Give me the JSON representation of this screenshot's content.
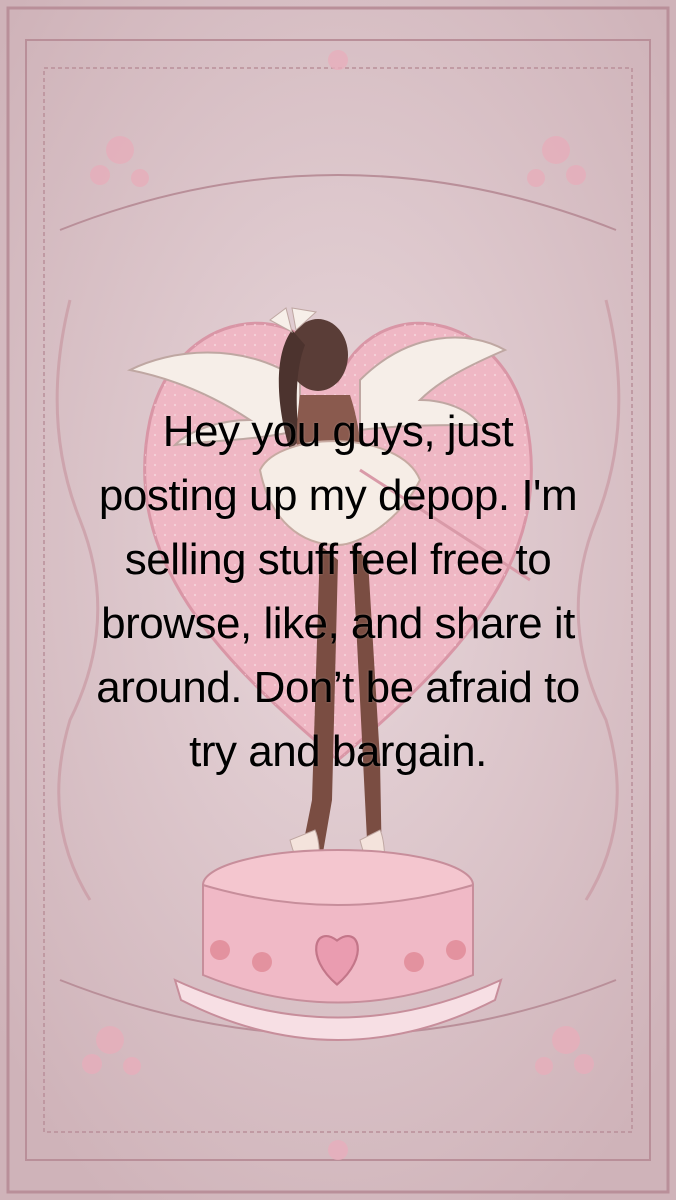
{
  "caption": {
    "line1": "Hey you guys, just",
    "line2": "posting up my depop. I'm",
    "line3": "selling stuff feel free to",
    "line4": "browse, like, and share it",
    "line5": "around. Don’t be afraid to",
    "line6": "try and bargain."
  },
  "colors": {
    "background": "#d9c2c6",
    "frame": "#caa6ae",
    "heart": "#efb7c4",
    "cake": "#f0b9c6",
    "text": "#000000"
  },
  "scene": {
    "subject": "angel-ballerina-figurine",
    "elements": [
      "ornate-frame",
      "heart",
      "cupid-girl",
      "wings",
      "cake-pedestal",
      "floral-ornaments"
    ]
  }
}
